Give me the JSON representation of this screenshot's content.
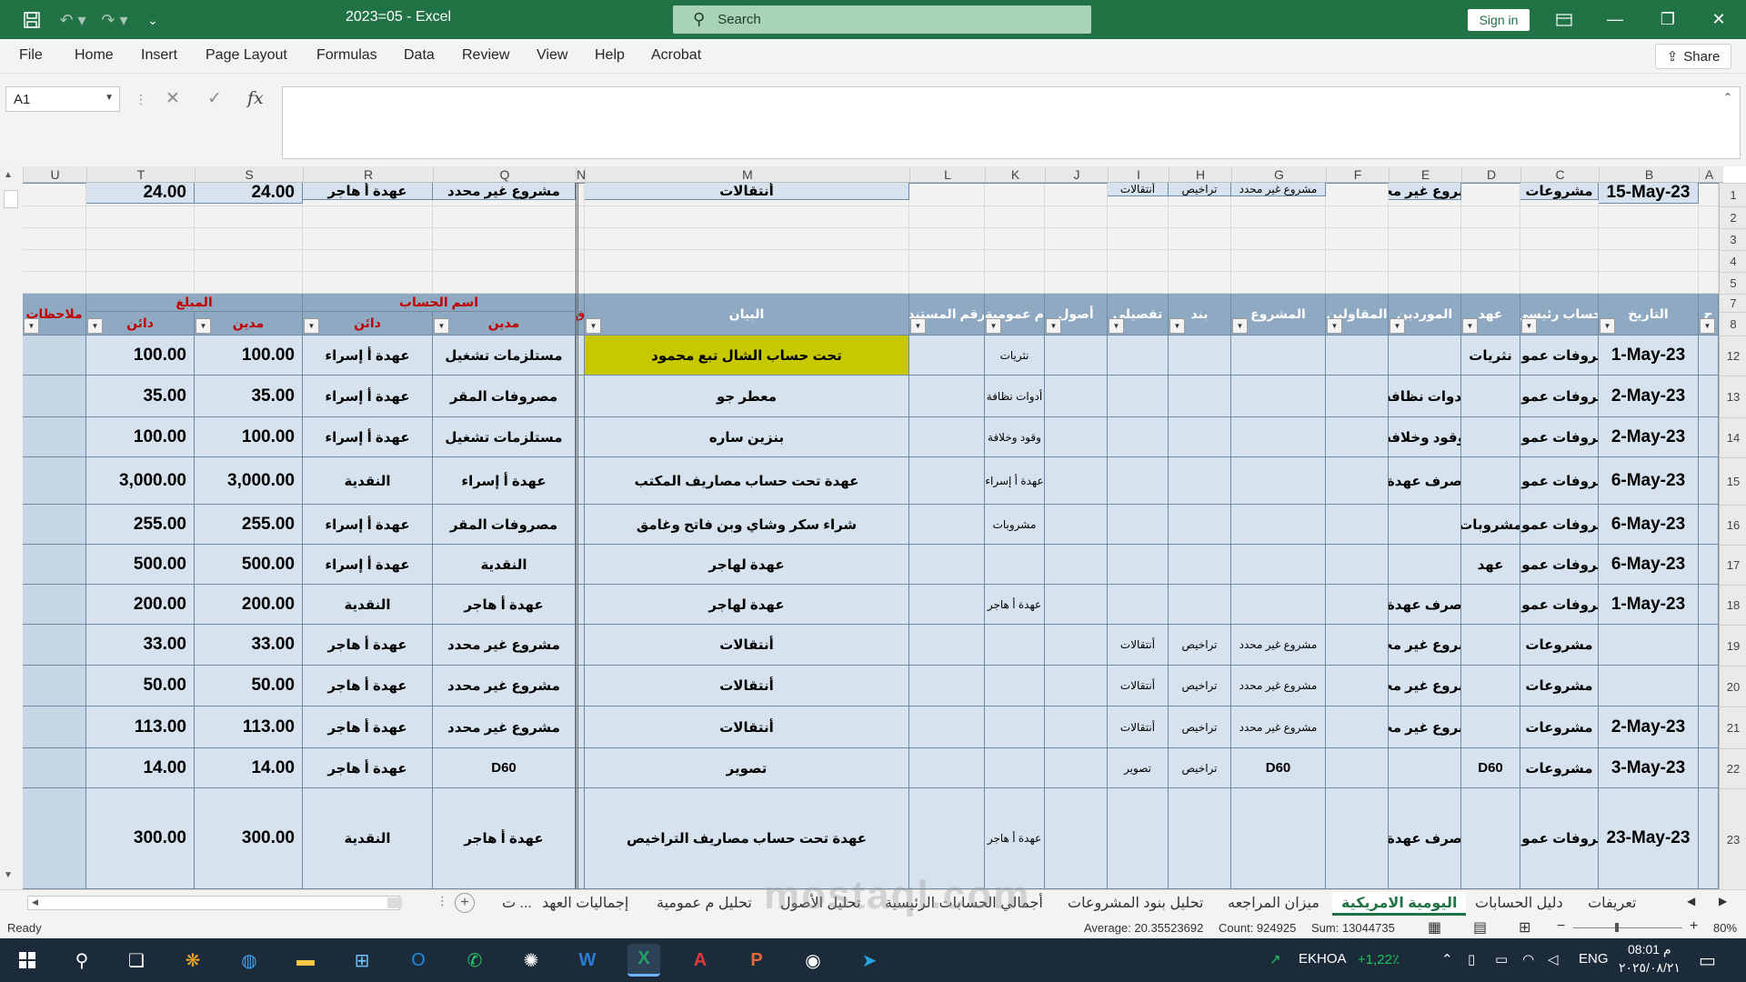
{
  "window": {
    "title": "2023=05  -  Excel",
    "search_placeholder": "Search",
    "sign_in": "Sign in",
    "controls": {
      "ribbon_display": "ribbon-display-icon",
      "minimize": "minimize-icon",
      "restore": "restore-icon",
      "close": "close-icon"
    }
  },
  "ribbon": {
    "tabs": [
      "File",
      "Home",
      "Insert",
      "Page Layout",
      "Formulas",
      "Data",
      "Review",
      "View",
      "Help",
      "Acrobat"
    ],
    "share": "Share"
  },
  "formula_bar": {
    "name_box": "A1",
    "fx": "fx",
    "value": ""
  },
  "columns": [
    "U",
    "T",
    "S",
    "R",
    "Q",
    "N",
    "M",
    "L",
    "K",
    "J",
    "I",
    "H",
    "G",
    "F",
    "E",
    "D",
    "C",
    "B",
    "A"
  ],
  "rows": [
    "1",
    "2",
    "3",
    "4",
    "5",
    "7",
    "8",
    "12",
    "13",
    "14",
    "15",
    "16",
    "17",
    "18",
    "19",
    "20",
    "21",
    "22",
    "23"
  ],
  "headers": {
    "notes": "ملاحظات",
    "amount_group": "المبلغ",
    "amount_credit": "دائن",
    "amount_debit": "مدين",
    "account_group": "اسم الحساب",
    "account_credit": "دائن",
    "account_debit": "مدين",
    "flag": "ق",
    "statement": "البيان",
    "doc_no": "رقم المستند",
    "general_exp": "م عمومية",
    "assets": "أصول",
    "detail": "تفصيلي",
    "item": "بند",
    "project": "المشروع",
    "contractors": "المقاولين",
    "suppliers": "الموردين",
    "custody": "عهد",
    "main_account": "حساب رئيسي",
    "date": "التاريخ",
    "partial": "ح"
  },
  "entries": [
    {
      "credit": "100.00",
      "debit": "100.00",
      "acc_credit": "عهدة أ إسراء",
      "acc_debit": "مستلزمات تشغيل",
      "statement": "تحت حساب الشال تبع محمود",
      "doc": "",
      "k": "نثريات",
      "j": "",
      "i": "",
      "h": "",
      "g": "",
      "f": "",
      "e": "",
      "d": "نثريات",
      "c": "مصروفات عمومية",
      "date": "1-May-23",
      "highlight": true
    },
    {
      "credit": "35.00",
      "debit": "35.00",
      "acc_credit": "عهدة أ إسراء",
      "acc_debit": "مصروفات المقر",
      "statement": "معطر جو",
      "doc": "",
      "k": "أدوات نظافة",
      "j": "",
      "i": "",
      "h": "",
      "g": "",
      "f": "",
      "e": "أدوات نظافة",
      "d": "",
      "c": "مصروفات عمومية",
      "date": "2-May-23",
      "highlight": false
    },
    {
      "credit": "100.00",
      "debit": "100.00",
      "acc_credit": "عهدة أ إسراء",
      "acc_debit": "مستلزمات تشغيل",
      "statement": "بنزين ساره",
      "doc": "",
      "k": "وقود وخلافة",
      "j": "",
      "i": "",
      "h": "",
      "g": "",
      "f": "",
      "e": "وقود وخلافة",
      "d": "",
      "c": "مصروفات عمومية",
      "date": "2-May-23",
      "highlight": false
    },
    {
      "credit": "3,000.00",
      "debit": "3,000.00",
      "acc_credit": "النقدية",
      "acc_debit": "عهدة أ إسراء",
      "statement": "عهدة تحت حساب مصاريف المكتب",
      "doc": "",
      "k": "عهدة أ إسراء",
      "j": "",
      "i": "",
      "h": "",
      "g": "",
      "f": "",
      "e": "صرف عهدة",
      "d": "",
      "c": "مصروفات عمومية",
      "date": "6-May-23",
      "highlight": false
    },
    {
      "credit": "255.00",
      "debit": "255.00",
      "acc_credit": "عهدة أ إسراء",
      "acc_debit": "مصروفات المقر",
      "statement": "شراء سكر وشاي وبن فاتح وغامق",
      "doc": "",
      "k": "مشروبات",
      "j": "",
      "i": "",
      "h": "",
      "g": "",
      "f": "",
      "e": "",
      "d": "مشروبات",
      "c": "مصروفات عمومية",
      "date": "6-May-23",
      "highlight": false
    },
    {
      "credit": "500.00",
      "debit": "500.00",
      "acc_credit": "عهدة أ إسراء",
      "acc_debit": "النقدية",
      "statement": "عهدة لهاجر",
      "doc": "",
      "k": "",
      "j": "",
      "i": "",
      "h": "",
      "g": "",
      "f": "",
      "e": "",
      "d": "عهد",
      "c": "مصروفات عمومية",
      "date": "6-May-23",
      "highlight": false
    },
    {
      "credit": "200.00",
      "debit": "200.00",
      "acc_credit": "النقدية",
      "acc_debit": "عهدة أ هاجر",
      "statement": "عهدة لهاجر",
      "doc": "",
      "k": "عهدة أ هاجر",
      "j": "",
      "i": "",
      "h": "",
      "g": "",
      "f": "",
      "e": "صرف عهدة",
      "d": "",
      "c": "مصروفات عمومية",
      "date": "1-May-23",
      "highlight": false
    },
    {
      "credit": "33.00",
      "debit": "33.00",
      "acc_credit": "عهدة أ هاجر",
      "acc_debit": "مشروع غير محدد",
      "statement": "أنتقالات",
      "doc": "",
      "k": "",
      "j": "",
      "i": "أنتقالات",
      "h": "تراخيص",
      "g": "مشروع غير محدد",
      "f": "",
      "e": "مشروع غير محدد",
      "d": "",
      "c": "مشروعات",
      "date": "",
      "highlight": false
    },
    {
      "credit": "50.00",
      "debit": "50.00",
      "acc_credit": "عهدة أ هاجر",
      "acc_debit": "مشروع غير محدد",
      "statement": "أنتقالات",
      "doc": "",
      "k": "",
      "j": "",
      "i": "أنتقالات",
      "h": "تراخيص",
      "g": "مشروع غير محدد",
      "f": "",
      "e": "مشروع غير محدد",
      "d": "",
      "c": "مشروعات",
      "date": "",
      "highlight": false
    },
    {
      "credit": "113.00",
      "debit": "113.00",
      "acc_credit": "عهدة أ هاجر",
      "acc_debit": "مشروع غير محدد",
      "statement": "أنتقالات",
      "doc": "",
      "k": "",
      "j": "",
      "i": "أنتقالات",
      "h": "تراخيص",
      "g": "مشروع غير محدد",
      "f": "",
      "e": "مشروع غير محدد",
      "d": "",
      "c": "مشروعات",
      "date": "2-May-23",
      "highlight": false
    },
    {
      "credit": "14.00",
      "debit": "14.00",
      "acc_credit": "عهدة أ هاجر",
      "acc_debit": "D60",
      "statement": "تصوير",
      "doc": "",
      "k": "",
      "j": "",
      "i": "تصوير",
      "h": "تراخيص",
      "g": "D60",
      "f": "",
      "e": "",
      "d": "D60",
      "c": "مشروعات",
      "date": "3-May-23",
      "highlight": false
    },
    {
      "credit": "300.00",
      "debit": "300.00",
      "acc_credit": "النقدية",
      "acc_debit": "عهدة أ هاجر",
      "statement": "عهدة تحت حساب مصاريف التراخيص",
      "doc": "",
      "k": "عهدة أ هاجر",
      "j": "",
      "i": "",
      "h": "",
      "g": "",
      "f": "",
      "e": "صرف عهدة",
      "d": "",
      "c": "مصروفات عمومية",
      "date": "23-May-23",
      "highlight": false
    },
    {
      "credit": "24.00",
      "debit": "24.00",
      "acc_credit": "عهدة أ هاجر",
      "acc_debit": "مشروع غير محدد",
      "statement": "أنتقالات",
      "doc": "",
      "k": "",
      "j": "",
      "i": "أنتقالات",
      "h": "تراخيص",
      "g": "مشروع غير محدد",
      "f": "",
      "e": "مشروع غير محدد",
      "d": "",
      "c": "مشروعات",
      "date": "15-May-23",
      "highlight": false
    }
  ],
  "sheets": {
    "tabs": [
      "تعريفات",
      "دليل الحسابات",
      "اليومية الامريكية",
      "ميزان المراجعه",
      "تحليل بنود المشروعات",
      "أجمالي الحسابات الرئيسية",
      "تحليل الأصول",
      "تحليل م عمومية",
      "إجماليات العهد",
      "ت ..."
    ],
    "active_index": 2
  },
  "status": {
    "ready": "Ready",
    "average": "Average: 20.35523692",
    "count": "Count: 924925",
    "sum": "Sum: 13044735",
    "zoom": "80%"
  },
  "taskbar": {
    "tray_ticker": "EKHOA",
    "tray_change": "+1,22٪",
    "lang": "ENG",
    "time": "08:01 م",
    "date": "٢٠٢٥/٠٨/٢١",
    "watermark": "mostaql.com"
  }
}
